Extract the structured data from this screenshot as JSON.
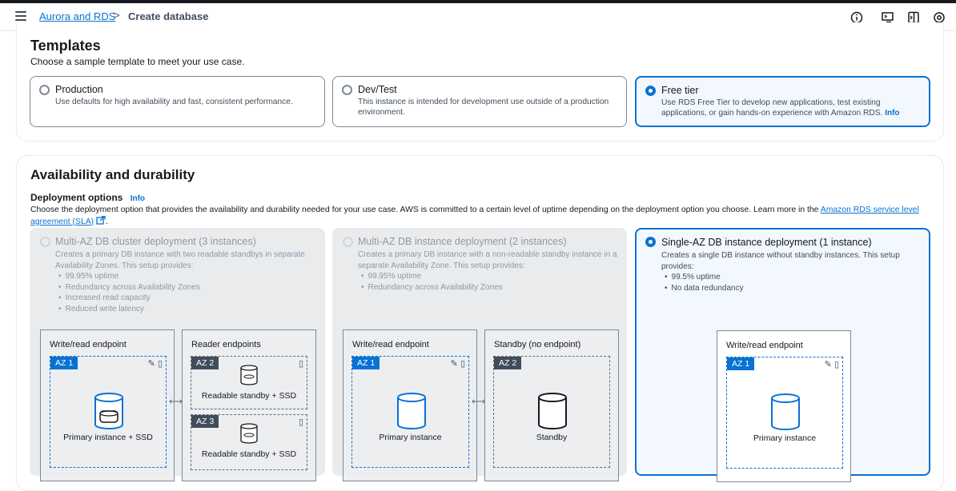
{
  "header": {
    "breadcrumb_parent": "Aurora and RDS",
    "breadcrumb_separator": ">",
    "breadcrumb_current": "Create database",
    "icons": [
      "info-icon",
      "cloudshell-icon",
      "side-panel-icon",
      "settings-icon"
    ]
  },
  "templates": {
    "title": "Templates",
    "description": "Choose a sample template to meet your use case.",
    "options": [
      {
        "label": "Production",
        "description": "Use defaults for high availability and fast, consistent performance.",
        "selected": false
      },
      {
        "label": "Dev/Test",
        "description": "This instance is intended for development use outside of a production environment.",
        "selected": false
      },
      {
        "label": "Free tier",
        "description": "Use RDS Free Tier to develop new applications, test existing applications, or gain hands-on experience with Amazon RDS.",
        "info": "Info",
        "selected": true
      }
    ]
  },
  "availability": {
    "title": "Availability and durability",
    "deployment_label": "Deployment options",
    "deployment_info": "Info",
    "description": "Choose the deployment option that provides the availability and durability needed for your use case. AWS is committed to a certain level of uptime depending on the deployment option you choose. Learn more in the",
    "sla_link": "Amazon RDS service level agreement (SLA)",
    "options": [
      {
        "label": "Multi-AZ DB cluster deployment (3 instances)",
        "description": "Creates a primary DB instance with two readable standbys in separate Availability Zones. This setup provides:",
        "bullets": [
          "99.95% uptime",
          "Redundancy across Availability Zones",
          "Increased read capacity",
          "Reduced write latency"
        ],
        "disabled": true,
        "diagram": {
          "left_endpoint": "Write/read endpoint",
          "right_endpoint": "Reader endpoints",
          "az1": "AZ 1",
          "az2": "AZ 2",
          "az3": "AZ 3",
          "primary": "Primary instance + SSD",
          "standby1": "Readable standby + SSD",
          "standby2": "Readable standby + SSD"
        }
      },
      {
        "label": "Multi-AZ DB instance deployment (2 instances)",
        "description": "Creates a primary DB instance with a non-readable standby instance in a separate Availability Zone. This setup provides:",
        "bullets": [
          "99.95% uptime",
          "Redundancy across Availability Zones"
        ],
        "disabled": true,
        "diagram": {
          "left_endpoint": "Write/read endpoint",
          "right_endpoint": "Standby (no endpoint)",
          "az1": "AZ 1",
          "az2": "AZ 2",
          "primary": "Primary instance",
          "standby": "Standby"
        }
      },
      {
        "label": "Single-AZ DB instance deployment (1 instance)",
        "description": "Creates a single DB instance without standby instances. This setup provides:",
        "bullets": [
          "99.5% uptime",
          "No data redundancy"
        ],
        "disabled": false,
        "selected": true,
        "diagram": {
          "left_endpoint": "Write/read endpoint",
          "az1": "AZ 1",
          "primary": "Primary instance"
        }
      }
    ]
  }
}
